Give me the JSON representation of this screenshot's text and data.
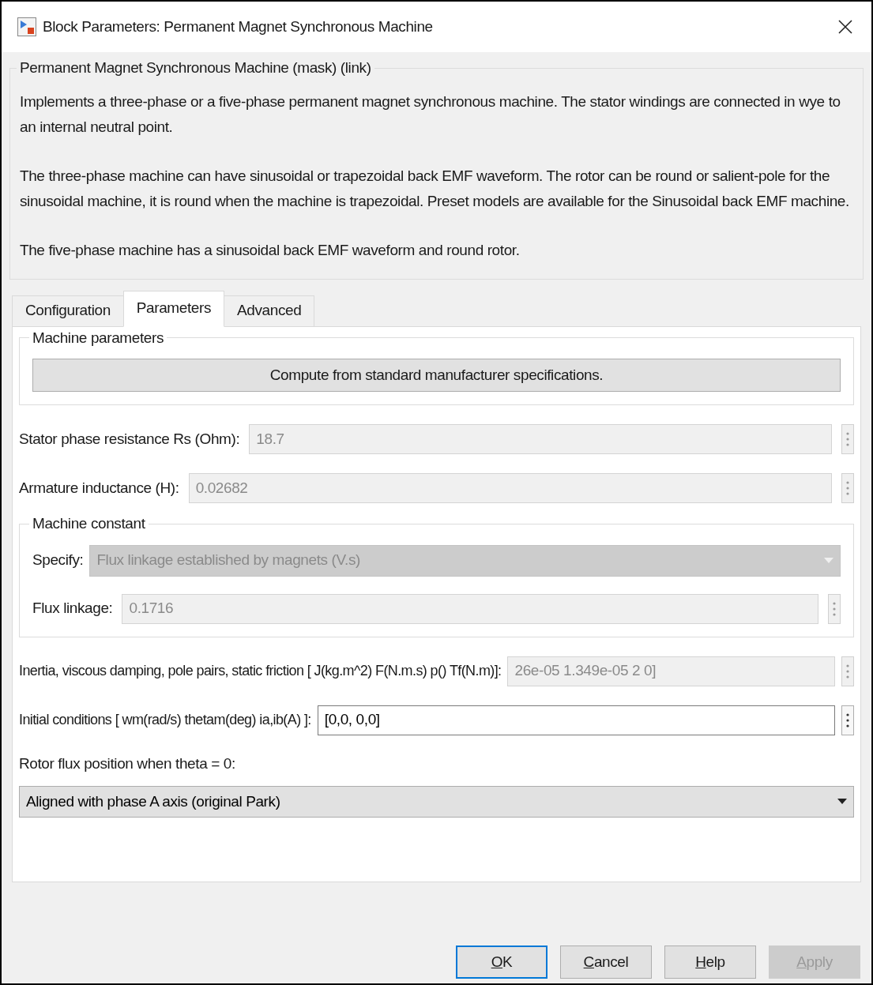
{
  "window": {
    "title": "Block Parameters: Permanent Magnet Synchronous Machine"
  },
  "description": {
    "title": "Permanent Magnet Synchronous Machine (mask) (link)",
    "paragraphs": [
      "Implements a three-phase or a five-phase permanent magnet synchronous machine. The stator windings are connected in wye to an internal neutral point.",
      "The three-phase machine can have sinusoidal or trapezoidal back EMF waveform. The rotor can be round or salient-pole for the sinusoidal machine, it is round when the machine is trapezoidal. Preset models are available for the Sinusoidal back EMF machine.",
      "The five-phase machine has a sinusoidal back EMF waveform and round rotor."
    ]
  },
  "tabs": [
    {
      "label": "Configuration",
      "selected": false
    },
    {
      "label": "Parameters",
      "selected": true
    },
    {
      "label": "Advanced",
      "selected": false
    }
  ],
  "machine_parameters": {
    "title": "Machine parameters",
    "button": "Compute from standard manufacturer specifications."
  },
  "fields_top": [
    {
      "label": "Stator phase resistance Rs (Ohm):",
      "value": "18.7",
      "disabled": true
    },
    {
      "label": "Armature inductance (H):",
      "value": "0.02682",
      "disabled": true
    }
  ],
  "machine_constant": {
    "title": "Machine constant",
    "specify": {
      "label": "Specify:",
      "value": "Flux linkage established by magnets (V.s)",
      "disabled": true
    },
    "flux": {
      "label": "Flux linkage:",
      "value": "0.1716",
      "disabled": true
    }
  },
  "fields_bottom": [
    {
      "label": "Inertia, viscous damping, pole pairs, static friction [ J(kg.m^2)  F(N.m.s)  p()  Tf(N.m)]:",
      "value": "26e-05 1.349e-05 2 0]",
      "disabled": true
    },
    {
      "label": "Initial conditions  [ wm(rad/s)  thetam(deg)  ia,ib(A) ]:",
      "value": "[0,0, 0,0]",
      "disabled": false
    }
  ],
  "rotor_flux": {
    "label": "Rotor flux position when theta = 0:",
    "value": "Aligned with phase A axis (original Park)",
    "disabled": false
  },
  "buttons": [
    {
      "label": "OK",
      "mnemonic": true,
      "default": true,
      "disabled": false
    },
    {
      "label": "Cancel",
      "mnemonic": true,
      "default": false,
      "disabled": false
    },
    {
      "label": "Help",
      "mnemonic": true,
      "default": false,
      "disabled": false
    },
    {
      "label": "Apply",
      "mnemonic": true,
      "default": false,
      "disabled": true
    }
  ]
}
